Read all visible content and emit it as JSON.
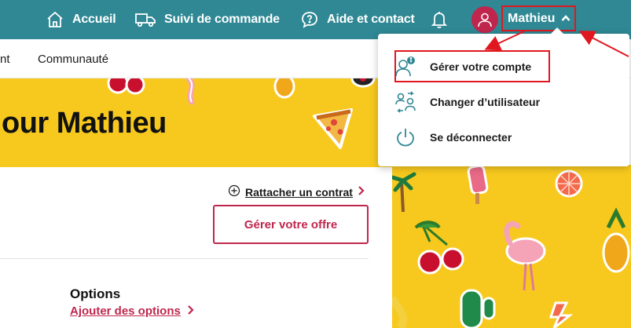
{
  "topnav": {
    "home_label": "Accueil",
    "tracking_label": "Suivi de commande",
    "help_label": "Aide et contact",
    "user_name": "Mathieu"
  },
  "subnav": {
    "item_partial": "nt",
    "community_label": "Communauté"
  },
  "banner": {
    "title": "our Mathieu"
  },
  "content": {
    "attach_link": "Rattacher un contrat",
    "offer_button": "Gérer votre offre",
    "options_title": "Options",
    "options_link": "Ajouter des options"
  },
  "dropdown": {
    "items": [
      {
        "label": "Gérer votre compte",
        "icon": "account-info-icon"
      },
      {
        "label": "Changer d’utilisateur",
        "icon": "switch-user-icon"
      },
      {
        "label": "Se déconnecter",
        "icon": "power-icon"
      }
    ]
  },
  "colors": {
    "topbar": "#2f8894",
    "accent": "#c0264d",
    "banner_yellow": "#f7c91e",
    "annotation_red": "#e0171f"
  }
}
